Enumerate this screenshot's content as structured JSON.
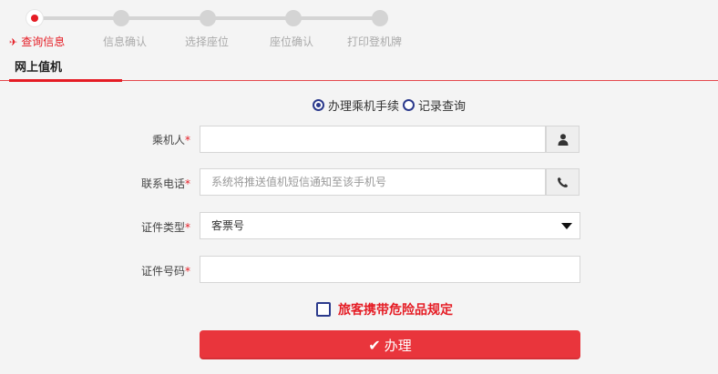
{
  "stepper": {
    "steps": [
      "查询信息",
      "信息确认",
      "选择座位",
      "座位确认",
      "打印登机牌"
    ],
    "plane_icon": "plane-icon"
  },
  "tab": {
    "label": "网上值机"
  },
  "radio_group": {
    "options": [
      "办理乘机手续",
      "记录查询"
    ],
    "selected": "办理乘机手续"
  },
  "form": {
    "passenger": {
      "label": "乘机人",
      "required_mark": "*",
      "value": "",
      "icon": "user-icon"
    },
    "phone": {
      "label": "联系电话",
      "required_mark": "*",
      "placeholder": "系统将推送值机短信通知至该手机号",
      "icon": "phone-icon"
    },
    "doc_type": {
      "label": "证件类型",
      "required_mark": "*",
      "value": "客票号"
    },
    "doc_number": {
      "label": "证件号码",
      "required_mark": "*",
      "value": ""
    }
  },
  "agreement": {
    "label": "旅客携带危险品规定",
    "checked": false
  },
  "submit": {
    "label": "办理",
    "icon": "check-icon"
  },
  "colors": {
    "accent": "#e51c24",
    "button": "#e9353c",
    "radio": "#2b3a8c"
  }
}
